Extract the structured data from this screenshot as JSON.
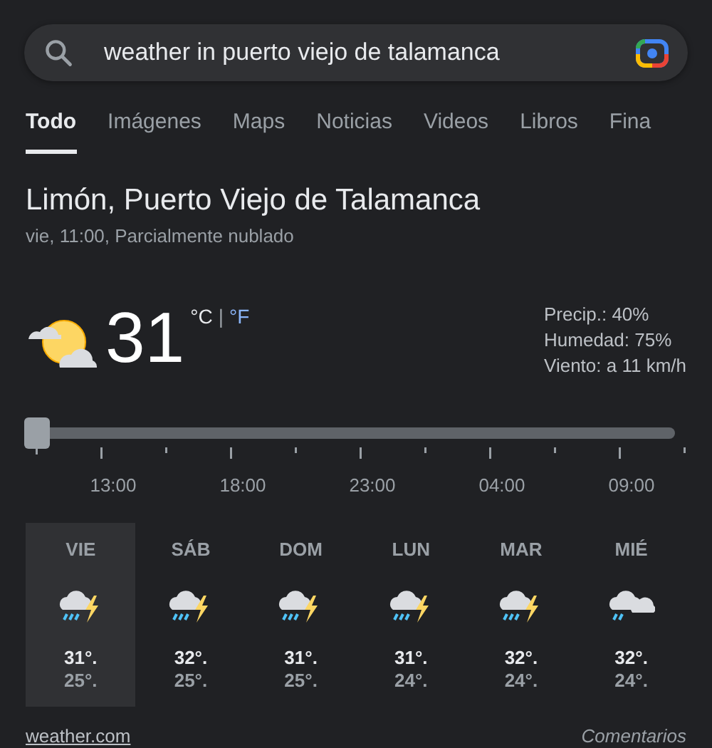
{
  "search": {
    "value": "weather in puerto viejo de talamanca"
  },
  "tabs": [
    {
      "label": "Todo",
      "selected": true
    },
    {
      "label": "Imágenes",
      "selected": false
    },
    {
      "label": "Maps",
      "selected": false
    },
    {
      "label": "Noticias",
      "selected": false
    },
    {
      "label": "Videos",
      "selected": false
    },
    {
      "label": "Libros",
      "selected": false
    },
    {
      "label": "Fina",
      "selected": false
    }
  ],
  "location": "Limón, Puerto Viejo de Talamanca",
  "subtitle": "vie, 11:00, Parcialmente nublado",
  "current": {
    "temperature": "31",
    "units": [
      {
        "label": "°C",
        "selected": true
      },
      {
        "label": "|",
        "kind": "separator"
      },
      {
        "label": "°F",
        "selected": false
      }
    ],
    "details": [
      "Precip.: 40%",
      "Humedad: 75%",
      "Viento: a 11 km/h"
    ]
  },
  "timeline": {
    "level": 0,
    "labels": [
      "13:00",
      "18:00",
      "23:00",
      "04:00",
      "09:00"
    ]
  },
  "forecast": [
    {
      "day": "VIE",
      "kind": "storm",
      "high": "31°.",
      "low": "25°.",
      "selected": true
    },
    {
      "day": "SÁB",
      "kind": "storm",
      "high": "32°.",
      "low": "25°.",
      "selected": false
    },
    {
      "day": "DOM",
      "kind": "storm",
      "high": "31°.",
      "low": "25°.",
      "selected": false
    },
    {
      "day": "LUN",
      "kind": "storm",
      "high": "31°.",
      "low": "24°.",
      "selected": false
    },
    {
      "day": "MAR",
      "kind": "storm",
      "high": "32°.",
      "low": "24°.",
      "selected": false
    },
    {
      "day": "MIÉ",
      "kind": "showers",
      "high": "32°.",
      "low": "24°.",
      "selected": false
    }
  ],
  "footer": {
    "source": "weather.com",
    "feedback": "Comentarios"
  }
}
